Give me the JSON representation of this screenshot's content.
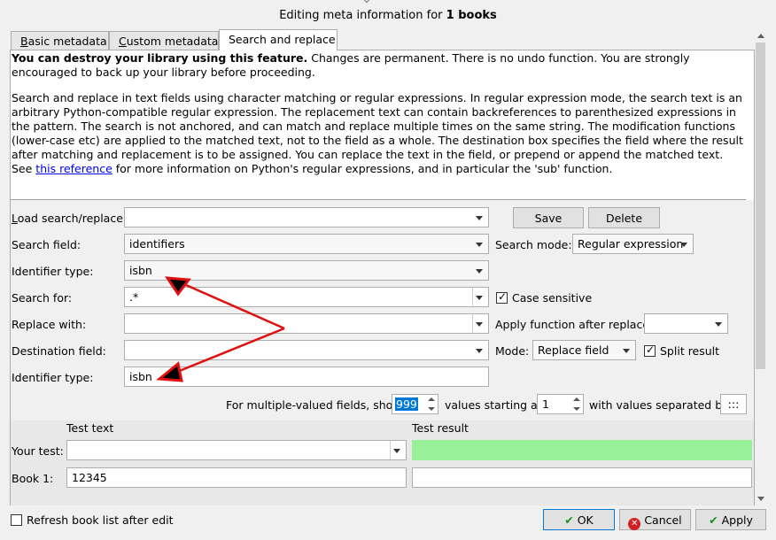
{
  "window": {
    "title_prefix": "Editing meta information for",
    "title_bold": "1 books"
  },
  "tabs": [
    {
      "label": "Basic metadata"
    },
    {
      "label": "Custom metadata"
    },
    {
      "label": "Search and replace"
    }
  ],
  "description": {
    "warning_bold": "You can destroy your library using this feature.",
    "warning_rest": " Changes are permanent. There is no undo function. You are strongly encouraged to back up your library before proceeding.",
    "body": "Search and replace in text fields using character matching or regular expressions. In regular expression mode, the search text is an arbitrary Python-compatible regular expression. The replacement text can contain backreferences to parenthesized expressions in the pattern. The search is not anchored, and can match and replace multiple times on the same string. The modification functions (lower-case etc) are applied to the matched text, not to the field as a whole. The destination box specifies the field where the result after matching and replacement is to be assigned. You can replace the text in the field, or prepend or append the matched text. See ",
    "link": "this reference",
    "body_end": " for more information on Python's regular expressions, and in particular the 'sub' function."
  },
  "form": {
    "load_label_u": "L",
    "load_label_rest": "oad search/replace:",
    "save_button": "Save",
    "delete_button": "Delete",
    "search_field_label": "Search field:",
    "search_field_value": "identifiers",
    "search_mode_label": "Search mode:",
    "search_mode_value": "Regular expression",
    "identifier_type_label": "Identifier type:",
    "identifier_type_value": "isbn",
    "search_for_label": "Search for:",
    "search_for_value": ".*",
    "case_sensitive_label": "Case sensitive",
    "replace_with_label": "Replace with:",
    "replace_with_value": "",
    "apply_function_label": "Apply function after replace:",
    "destination_field_label": "Destination field:",
    "destination_field_value": "",
    "mode_label": "Mode:",
    "mode_value": "Replace field",
    "split_result_label": "Split result",
    "dest_identifier_type_label": "Identifier type:",
    "dest_identifier_type_value": "isbn",
    "multi_show_label": "For multiple-valued fields, show",
    "multi_show_value": "999",
    "values_starting_label": "values starting at",
    "values_starting_value": "1",
    "separated_by_label": "with values separated by",
    "separator_value": ":::"
  },
  "test": {
    "test_text_header": "Test text",
    "test_result_header": "Test result",
    "your_test_label": "Your test:",
    "your_test_value": "",
    "book1_label": "Book 1:",
    "book1_value": "12345",
    "book1_result": ""
  },
  "footer": {
    "refresh_label": "Refresh book list after edit",
    "ok_button": "OK",
    "cancel_button": "Cancel",
    "apply_button": "Apply"
  },
  "colors": {
    "annotation_arrows": "#e01010",
    "test_result_bg": "#98f098",
    "link": "#0000ee"
  }
}
